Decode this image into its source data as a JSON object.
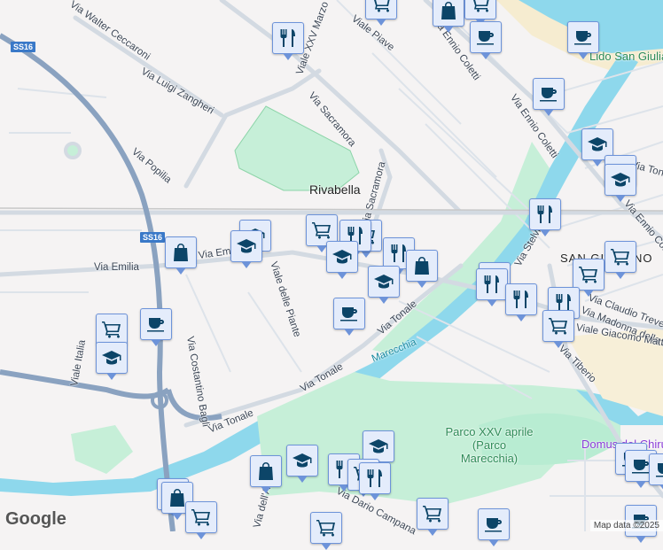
{
  "map": {
    "places": {
      "rivabella": "Rivabella",
      "san_giuliano": "SAN GIULIANO",
      "lido": "Lido San Giuliano",
      "park": "Parco XXV aprile (Parco Marecchia)",
      "river": "Marecchia",
      "domus": "Domus del Chirurgo"
    },
    "roads": {
      "walter_ceccaroni": "Via Walter Ceccaroni",
      "zangheri": "Via Luigi Zangheri",
      "popilia": "Via Popilia",
      "xxv_marzo": "Viale XXV Marzo",
      "piave": "Viale Piave",
      "sacramora": "Via Sacramora",
      "sacramora2": "Via Sacramora",
      "coletti1": "Via Ennio Coletti",
      "coletti2": "Via Ennio Coletti",
      "coletti3": "Via Ennio Coletti",
      "emilia": "Via Emilia",
      "emilia2": "Via Emilia",
      "piante": "Viale delle Piante",
      "italia": "Viale Italia",
      "bagli": "Via Costantino Bagli",
      "tonale1": "Via Tonale",
      "tonale2": "Via Tonale",
      "tonale3": "Via Tonale",
      "tonale4": "Via Tonale",
      "stelvio": "Via Stelvio",
      "treves": "Via Claudio Treves",
      "madonna": "Via Madonna della Scala",
      "matteotti": "Viale Giacomo Matteotti",
      "tiberio": "Via Tiberio",
      "campana": "Via Dario Campana",
      "ausa": "Via dell'Ausa"
    },
    "shields": [
      "SS16",
      "SS16"
    ],
    "attribution": "Map data ©2025",
    "logo": "Google"
  }
}
